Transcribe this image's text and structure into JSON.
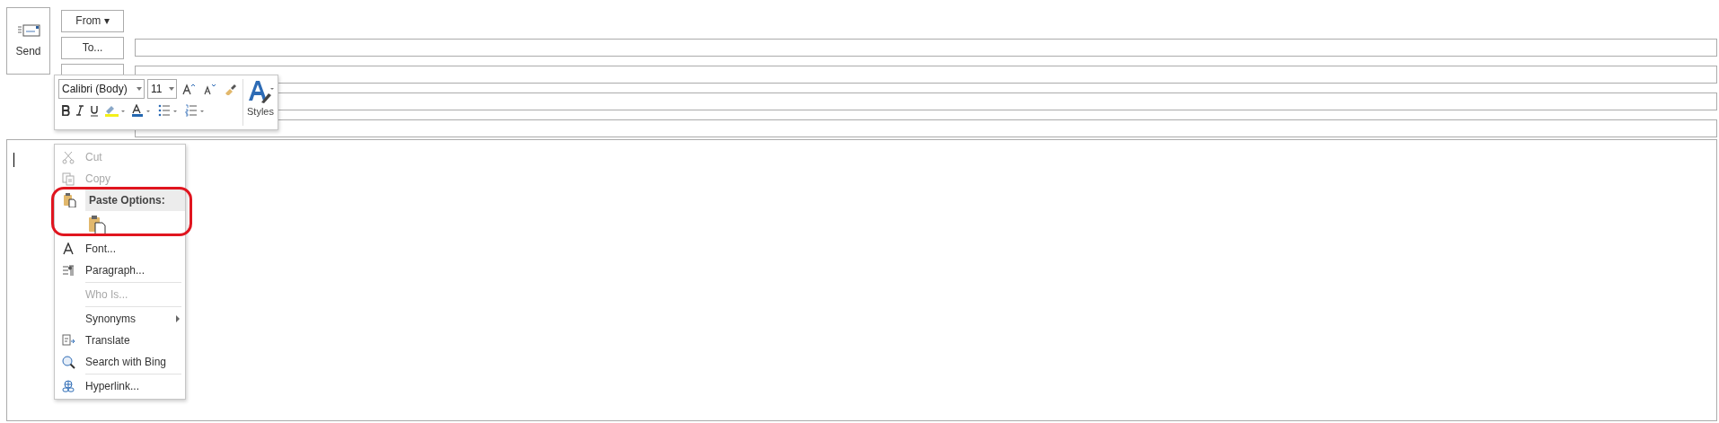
{
  "send_button": {
    "label": "Send"
  },
  "header_rows": [
    {
      "button": "From ▾",
      "has_field": false
    },
    {
      "button": "To...",
      "has_field": true
    },
    {
      "covered_button": true,
      "has_field": true
    },
    {
      "has_field": true
    },
    {
      "has_field": true
    }
  ],
  "mini_toolbar": {
    "font_name": "Calibri (Body)",
    "font_size": "11",
    "styles_label": "Styles"
  },
  "context_menu": [
    {
      "kind": "item",
      "label": "Cut",
      "disabled": true
    },
    {
      "kind": "item",
      "label": "Copy",
      "disabled": true
    },
    {
      "kind": "header",
      "label": "Paste Options:"
    },
    {
      "kind": "paste"
    },
    {
      "kind": "item",
      "label": "Font...",
      "disabled": false
    },
    {
      "kind": "item",
      "label": "Paragraph...",
      "disabled": false
    },
    {
      "kind": "separator"
    },
    {
      "kind": "item",
      "label": "Who Is...",
      "disabled": true
    },
    {
      "kind": "separator"
    },
    {
      "kind": "submenu",
      "label": "Synonyms",
      "disabled": false
    },
    {
      "kind": "item",
      "label": "Translate",
      "disabled": false
    },
    {
      "kind": "item",
      "label": "Search with Bing",
      "disabled": false
    },
    {
      "kind": "separator"
    },
    {
      "kind": "item",
      "label": "Hyperlink...",
      "disabled": false
    }
  ],
  "highlight_outline": true
}
